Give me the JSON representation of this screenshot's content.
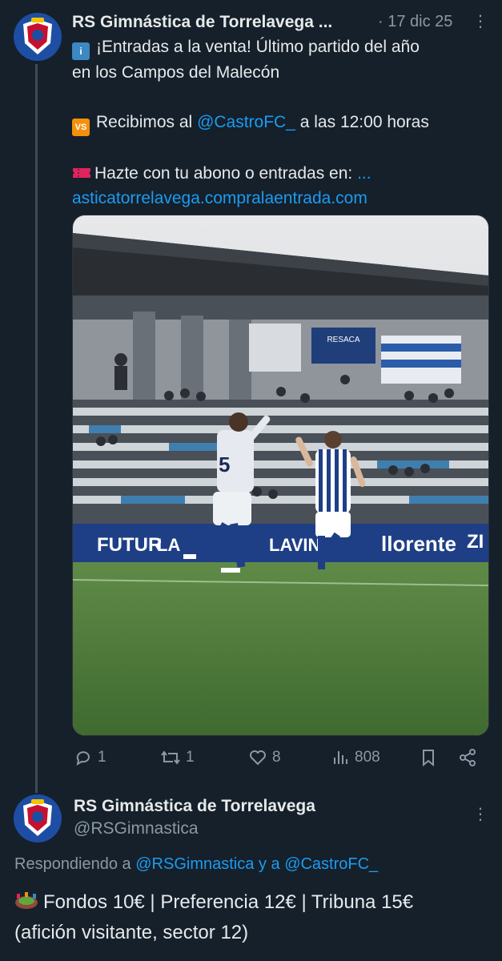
{
  "tweet1": {
    "author_name": "RS Gimnástica de Torrelavega ...",
    "timestamp": "· 17 dic 25",
    "line1_icon": "info-icon",
    "line1_text": "¡Entradas a la venta! Último partido del año",
    "line2_text": "en los Campos del Malecón",
    "vs_icon_text": "VS",
    "vs_prefix": "Recibimos al",
    "vs_mention": "@CastroFC_",
    "vs_suffix": "a las 12:00 horas",
    "ticket_icon": "ticket-icon",
    "ticket_text": "Hazte con tu abono o entradas en:",
    "ticket_ellipsis": "...",
    "link_text": "asticatorrelavega.compralaentrada.com",
    "media": {
      "banner_text_1": "FUTUR",
      "banner_text_2": "LAVIN",
      "banner_text_3": "llorente",
      "banner_text_4": "ZI",
      "banner_text_5": "RESACA",
      "jersey_number": "5"
    },
    "actions": {
      "replies": "1",
      "retweets": "1",
      "likes": "8",
      "views": "808"
    }
  },
  "tweet2": {
    "author_name": "RS Gimnástica de Torrelavega",
    "handle": "@RSGimnastica",
    "replying_prefix": "Respondiendo a",
    "replying_user1": "@RSGimnastica",
    "replying_and": "y a",
    "replying_user2": "@CastroFC_",
    "stadium_icon": "stadium-icon",
    "body_line1": "Fondos 10€ | Preferencia 12€ | Tribuna 15€",
    "body_line2": "(afición visitante, sector 12)"
  },
  "colors": {
    "background": "#15202b",
    "link": "#1d9bf0",
    "muted": "#8b98a5",
    "vs_orange": "#f4900c",
    "info_blue": "#3b88c3"
  }
}
